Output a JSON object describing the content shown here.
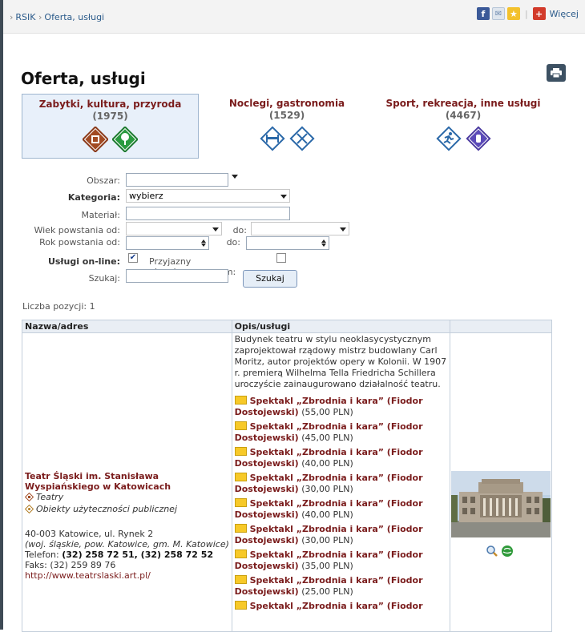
{
  "header": {
    "breadcrumb": [
      "RSIK",
      "Oferta, usługi"
    ],
    "share_more": "Więcej",
    "share_icons": [
      "facebook-icon",
      "mail-icon",
      "favorite-icon",
      "plus-icon"
    ]
  },
  "page": {
    "title": "Oferta, usługi"
  },
  "categories": [
    {
      "name": "Zabytki, kultura, przyroda",
      "count": "(1975)",
      "icons": [
        "theatre-icon",
        "tree-icon"
      ],
      "active": true
    },
    {
      "name": "Noclegi, gastronomia",
      "count": "(1529)",
      "icons": [
        "bed-icon",
        "cutlery-icon"
      ]
    },
    {
      "name": "Sport, rekreacja, inne usługi",
      "count": "(4467)",
      "icons": [
        "runner-icon",
        "hand-icon"
      ]
    }
  ],
  "form": {
    "obszar_label": "Obszar:",
    "obszar_value": "",
    "kategoria_label": "Kategoria:",
    "kategoria_value": "wybierz",
    "material_label": "Materiał:",
    "material_value": "",
    "wiek_label": "Wiek powstania od:",
    "wiek_do_label": "do:",
    "rok_label": "Rok powstania od:",
    "rok_do_label": "do:",
    "uslugi_label": "Usługi on-line:",
    "uslugi_checked": true,
    "przyjazny_label": "Przyjazny niepełnosprawnym:",
    "przyjazny_checked": false,
    "szukaj_label": "Szukaj:",
    "szukaj_value": "",
    "search_button": "Szukaj"
  },
  "results": {
    "count_label": "Liczba pozycji: 1",
    "columns": [
      "Nazwa/adres",
      "Opis/usługi",
      ""
    ],
    "item": {
      "name": "Teatr Śląski im. Stanisława Wyspiańskiego w Katowicach",
      "tags": [
        "Teatry",
        "Obiekty użyteczności publicznej"
      ],
      "address": "40-003 Katowice, ul. Rynek 2",
      "region": "(woj. śląskie, pow. Katowice, gm. M. Katowice)",
      "phone_label": "Telefon:",
      "phone": "(32) 258 72 51, (32) 258 72 52",
      "fax": "Faks: (32) 259 89 76",
      "url": "http://www.teatrslaski.art.pl/",
      "description": "Budynek teatru w stylu neoklasycystycznym zaprojektował rządowy mistrz budowlany Carl Moritz, autor projektów opery w Kolonii. W 1907 r. premierą Wilhelma Tella Friedricha Schillera uroczyście zainaugurowano działalność teatru.",
      "offers": [
        {
          "name": "Spektakl „Zbrodnia i kara” (Fiodor Dostojewski)",
          "price": "(55,00 PLN)"
        },
        {
          "name": "Spektakl „Zbrodnia i kara” (Fiodor Dostojewski)",
          "price": "(45,00 PLN)"
        },
        {
          "name": "Spektakl „Zbrodnia i kara” (Fiodor Dostojewski)",
          "price": "(40,00 PLN)"
        },
        {
          "name": "Spektakl „Zbrodnia i kara” (Fiodor Dostojewski)",
          "price": "(30,00 PLN)"
        },
        {
          "name": "Spektakl „Zbrodnia i kara” (Fiodor Dostojewski)",
          "price": "(40,00 PLN)"
        },
        {
          "name": "Spektakl „Zbrodnia i kara” (Fiodor Dostojewski)",
          "price": "(30,00 PLN)"
        },
        {
          "name": "Spektakl „Zbrodnia i kara” (Fiodor Dostojewski)",
          "price": "(35,00 PLN)"
        },
        {
          "name": "Spektakl „Zbrodnia i kara” (Fiodor Dostojewski)",
          "price": "(25,00 PLN)"
        },
        {
          "name": "Spektakl „Zbrodnia i kara” (Fiodor",
          "price": ""
        }
      ],
      "photo_icons": [
        "zoom-icon",
        "map-globe-icon"
      ]
    }
  },
  "colors": {
    "accent_dark_red": "#7a1c1c",
    "link_blue": "#2a5a8a",
    "header_bg": "#e9eef4"
  }
}
